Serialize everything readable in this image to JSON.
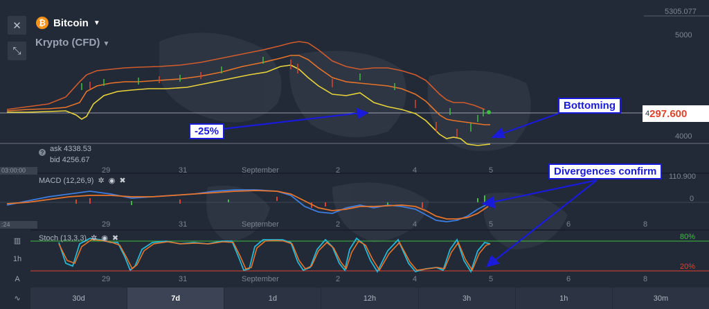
{
  "asset": {
    "title": "Bitcoin",
    "logo_glyph": "₿",
    "subtitle": "Krypto (CFD)"
  },
  "left_buttons": {
    "close_glyph": "✕",
    "expand_glyph": "⤡"
  },
  "price_axis": {
    "top_partial": "5305.077",
    "level_5000": "5000",
    "level_4000": "4000",
    "current_prefix": "4",
    "current_price": "297.600"
  },
  "quote": {
    "ask": "ask 4338.53",
    "bid": "bid 4256.67"
  },
  "time_chips": {
    "main": "03:00:00",
    "macd": ":24"
  },
  "x_axis": {
    "main": [
      "29",
      "31",
      "September",
      "2",
      "4",
      "5"
    ],
    "macd": [
      "29",
      "31",
      "September",
      "2",
      "4",
      "5",
      "6",
      "8"
    ],
    "stoch": [
      "29",
      "31",
      "September",
      "2",
      "4",
      "5",
      "6",
      "8"
    ]
  },
  "macd": {
    "label": "MACD (12,26,9)",
    "value_right": "110.900",
    "zero_label": "0"
  },
  "stoch": {
    "label": "Stoch (13,3,3)",
    "upper": "80%",
    "lower": "20%"
  },
  "icons": {
    "settings": "✲",
    "visibility": "◉",
    "remove": "✖"
  },
  "annotations": {
    "bottoming": "Bottoming",
    "drop": "-25%",
    "divergences": "Divergences confirm"
  },
  "sidebar_tools": {
    "chart_type": "▥",
    "timeframe": "1h",
    "draw": "A",
    "indicators": "∿"
  },
  "periods": [
    {
      "label": "30d",
      "active": false
    },
    {
      "label": "7d",
      "active": true
    },
    {
      "label": "1d",
      "active": false
    },
    {
      "label": "12h",
      "active": false
    },
    {
      "label": "3h",
      "active": false
    },
    {
      "label": "1h",
      "active": false
    },
    {
      "label": "30m",
      "active": false
    }
  ],
  "colors": {
    "price_line": "#e0432d",
    "upper_band": "#d05b2c",
    "lower_band": "#e8d43a",
    "macd_line": "#3d7ee0",
    "signal_line": "#e8742a",
    "stoch_k": "#22b8d8",
    "stoch_d": "#e8742a",
    "level_80": "#3fbf3f",
    "level_20": "#e0432d",
    "annotation_blue": "#1a1adb"
  }
}
